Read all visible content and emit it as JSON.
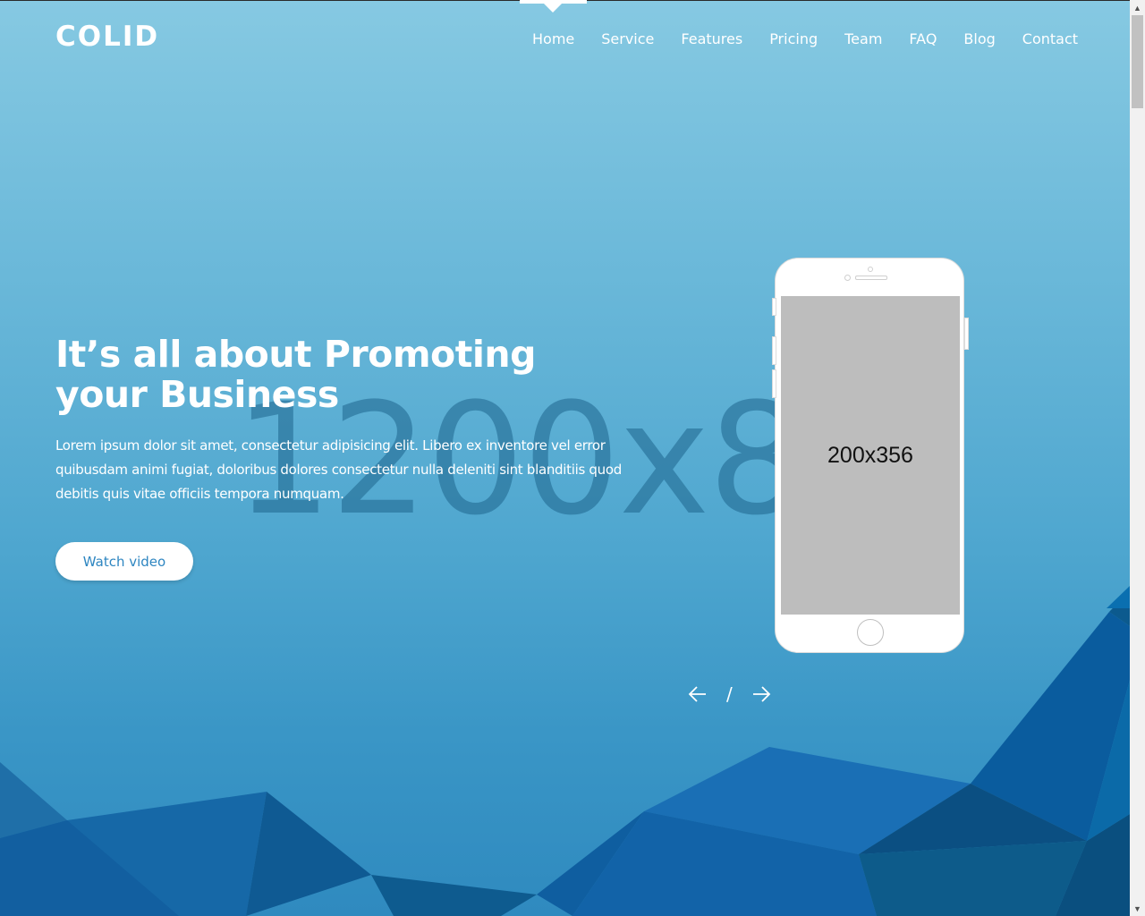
{
  "brand": {
    "logo": "COLID"
  },
  "nav": {
    "items": [
      {
        "label": "Home",
        "active": true
      },
      {
        "label": "Service"
      },
      {
        "label": "Features"
      },
      {
        "label": "Pricing"
      },
      {
        "label": "Team"
      },
      {
        "label": "FAQ"
      },
      {
        "label": "Blog"
      },
      {
        "label": "Contact"
      }
    ]
  },
  "hero": {
    "title": "It’s all about Promoting your Business",
    "text": "Lorem ipsum dolor sit amet, consectetur adipisicing elit. Libero ex inventore vel error quibusdam animi fugiat, doloribus dolores consectetur nulla deleniti sint blanditiis quod debitis quis vitae officiis tempora numquam.",
    "button": "Watch video",
    "background_placeholder": "1200x80"
  },
  "phone": {
    "screen_placeholder": "200x356"
  },
  "slider": {
    "separator": "/",
    "prev_icon": "arrow-left-icon",
    "next_icon": "arrow-right-icon"
  },
  "colors": {
    "accent": "#2e86c1",
    "white": "#ffffff"
  }
}
